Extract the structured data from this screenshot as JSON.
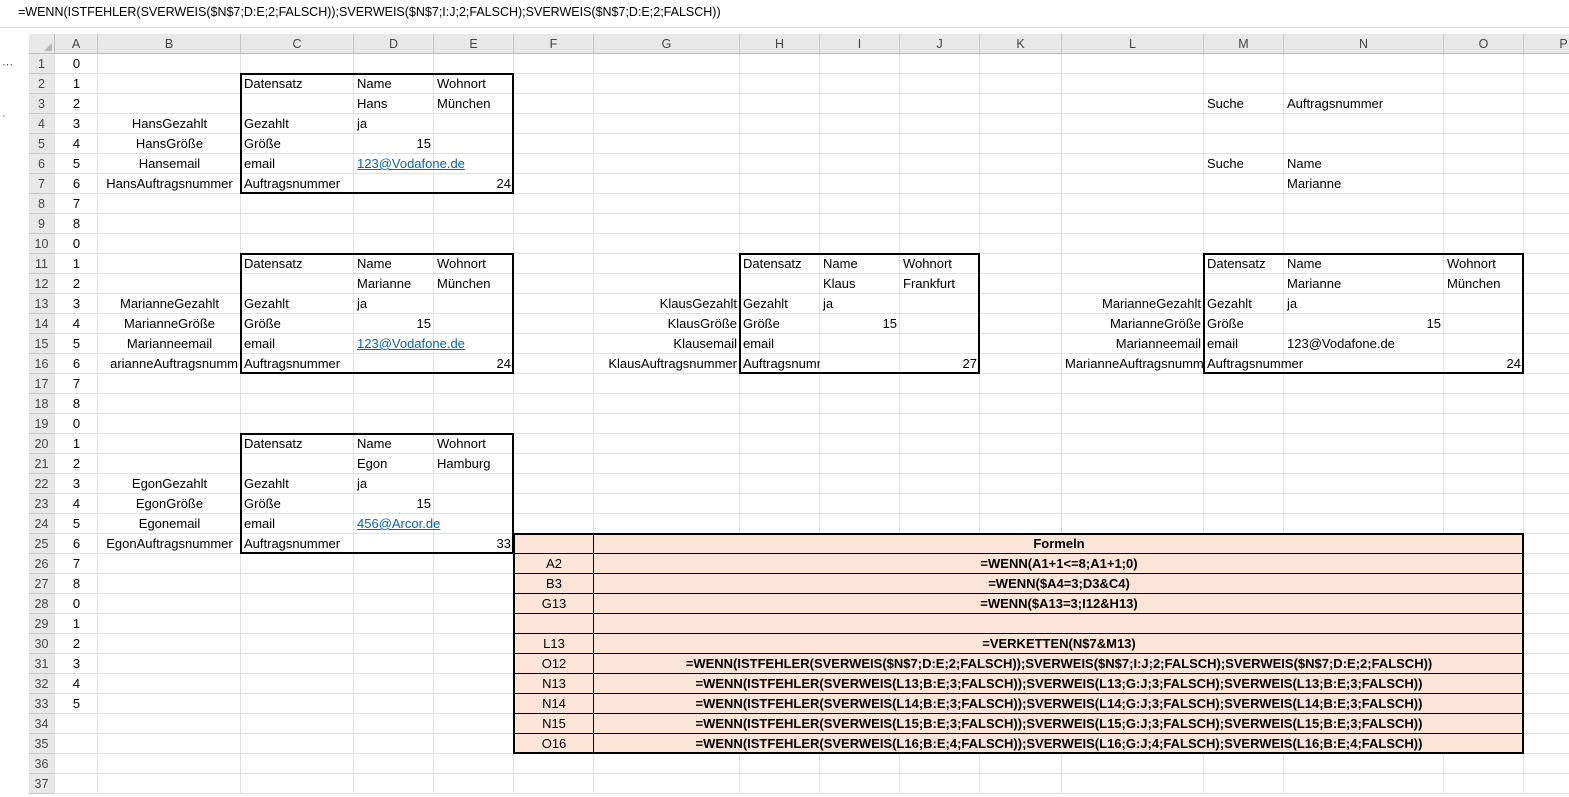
{
  "formula_bar": {
    "text": "=WENN(ISTFEHLER(SVERWEIS($N$7;D:E;2;FALSCH));SVERWEIS($N$7;I:J;2;FALSCH);SVERWEIS($N$7;D:E;2;FALSCH))"
  },
  "columns": [
    "A",
    "B",
    "C",
    "D",
    "E",
    "F",
    "G",
    "H",
    "I",
    "J",
    "K",
    "L",
    "M",
    "N",
    "O",
    "P"
  ],
  "rows": [
    "1",
    "2",
    "3",
    "4",
    "5",
    "6",
    "7",
    "8",
    "9",
    "10",
    "11",
    "12",
    "13",
    "14",
    "15",
    "16",
    "17",
    "18",
    "19",
    "20",
    "21",
    "22",
    "23",
    "24",
    "25",
    "26",
    "27",
    "28",
    "29",
    "30",
    "31",
    "32",
    "33",
    "34",
    "35",
    "36",
    "37"
  ],
  "col_a_values": [
    "0",
    "1",
    "2",
    "3",
    "4",
    "5",
    "6",
    "7",
    "8",
    "0",
    "1",
    "2",
    "3",
    "4",
    "5",
    "6",
    "7",
    "8",
    "0",
    "1",
    "2",
    "3",
    "4",
    "5",
    "6",
    "7",
    "8",
    "0",
    "1",
    "2",
    "3",
    "4",
    "5"
  ],
  "header": {
    "datensatz": "Datensatz",
    "name": "Name",
    "wohnort": "Wohnort"
  },
  "fields": {
    "gezahlt": "Gezahlt",
    "groesse": "Größe",
    "email": "email",
    "auftragsnummer": "Auftragsnummer"
  },
  "hans": {
    "name": "Hans",
    "wohnort": "München",
    "gezahlt_label": "HansGezahlt",
    "groesse_label": "HansGröße",
    "email_label": "Hansemail",
    "auftrag_label": "HansAuftragsnummer",
    "gezahlt": "ja",
    "groesse": "15",
    "email": "123@Vodafone.de",
    "auftrag": "24"
  },
  "marianne": {
    "name": "Marianne",
    "wohnort": "München",
    "gezahlt_label": "MarianneGezahlt",
    "groesse_label": "MarianneGröße",
    "email_label": "Marianneemail",
    "auftrag_label": "arianneAuftragsnumm",
    "gezahlt": "ja",
    "groesse": "15",
    "email": "123@Vodafone.de",
    "auftrag": "24"
  },
  "egon": {
    "name": "Egon",
    "wohnort": "Hamburg",
    "gezahlt_label": "EgonGezahlt",
    "groesse_label": "EgonGröße",
    "email_label": "Egonemail",
    "auftrag_label": "EgonAuftragsnummer",
    "gezahlt": "ja",
    "groesse": "15",
    "email": "456@Arcor.de",
    "auftrag": "33"
  },
  "klaus": {
    "name": "Klaus",
    "wohnort": "Frankfurt",
    "gezahlt_label": "KlausGezahlt",
    "groesse_label": "KlausGröße",
    "email_label": "Klausemail",
    "auftrag_label": "KlausAuftragsnummer",
    "gezahlt": "ja",
    "groesse": "15",
    "auftrag": "27"
  },
  "lookup": {
    "suche1": "Suche",
    "suche1_value": "Auftragsnummer",
    "suche2": "Suche",
    "suche2_value": "Name",
    "search_term": "Marianne"
  },
  "result": {
    "name": "Marianne",
    "wohnort": "München",
    "gezahlt_label": "MarianneGezahlt",
    "groesse_label": "MarianneGröße",
    "email_label": "Marianneemail",
    "auftrag_label": "MarianneAuftragsnumm",
    "gezahlt": "ja",
    "groesse": "15",
    "email": "123@Vodafone.de",
    "auftrag": "24"
  },
  "formulas": {
    "title": "Formeln",
    "rows": [
      {
        "cell": "A2",
        "formula": "=WENN(A1+1<=8;A1+1;0)"
      },
      {
        "cell": "B3",
        "formula": "=WENN($A4=3;D3&C4)"
      },
      {
        "cell": "G13",
        "formula": "=WENN($A13=3;I12&H13)"
      },
      {
        "cell": "",
        "formula": ""
      },
      {
        "cell": "L13",
        "formula": "=VERKETTEN(N$7&M13)"
      },
      {
        "cell": "O12",
        "formula": "=WENN(ISTFEHLER(SVERWEIS($N$7;D:E;2;FALSCH));SVERWEIS($N$7;I:J;2;FALSCH);SVERWEIS($N$7;D:E;2;FALSCH))"
      },
      {
        "cell": "N13",
        "formula": "=WENN(ISTFEHLER(SVERWEIS(L13;B:E;3;FALSCH));SVERWEIS(L13;G:J;3;FALSCH);SVERWEIS(L13;B:E;3;FALSCH))"
      },
      {
        "cell": "N14",
        "formula": "=WENN(ISTFEHLER(SVERWEIS(L14;B:E;3;FALSCH));SVERWEIS(L14;G:J;3;FALSCH);SVERWEIS(L14;B:E;3;FALSCH))"
      },
      {
        "cell": "N15",
        "formula": "=WENN(ISTFEHLER(SVERWEIS(L15;B:E;3;FALSCH));SVERWEIS(L15;G:J;3;FALSCH);SVERWEIS(L15;B:E;3;FALSCH))"
      },
      {
        "cell": "O16",
        "formula": "=WENN(ISTFEHLER(SVERWEIS(L16;B:E;4;FALSCH));SVERWEIS(L16;G:J;4;FALSCH);SVERWEIS(L16;B:E;4;FALSCH))"
      }
    ]
  }
}
